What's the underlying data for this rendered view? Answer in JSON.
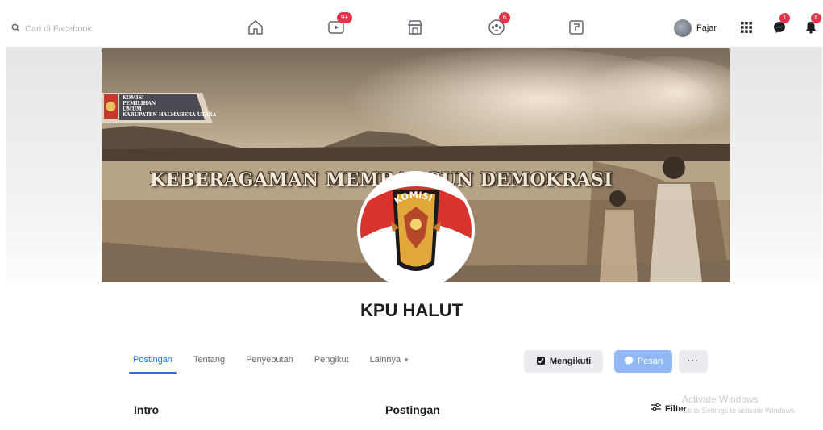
{
  "search": {
    "placeholder": "Cari di Facebook"
  },
  "nav": {
    "home_icon": "home-icon",
    "watch_badge": "9+",
    "groups_badge": "6"
  },
  "profile": {
    "name": "Fajar"
  },
  "notifications": {
    "messenger_badge": "1",
    "bell_badge": "6"
  },
  "cover": {
    "slogan": "KEBERAGAMAN MEMBANGUN DEMOKRASI",
    "label": "KOMISI\nPEMILIHAN\nUMUM\nKABUPATEN HALMAHERA UTARA"
  },
  "page": {
    "title": "KPU HALUT"
  },
  "tabs": [
    {
      "label": "Postingan",
      "active": true
    },
    {
      "label": "Tentang"
    },
    {
      "label": "Penyebutan"
    },
    {
      "label": "Pengikut"
    },
    {
      "label": "Lainnya"
    }
  ],
  "actions": {
    "follow_label": "Mengikuti",
    "message_label": "Pesan",
    "more_label": "···"
  },
  "sections": {
    "intro": "Intro",
    "posts": "Postingan",
    "filter": "Filter"
  },
  "watermark": {
    "title": "Activate Windows",
    "subtitle": "Go to Settings to activate Windows."
  },
  "colors": {
    "accent": "#1877f2",
    "badge": "#e4344a",
    "message_button": "#8fb8f4",
    "cover_tone": "#b59c7c"
  }
}
